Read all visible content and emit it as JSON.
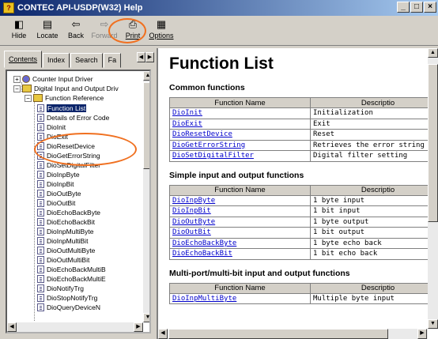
{
  "window": {
    "title": "CONTEC API-USDP(W32) Help"
  },
  "toolbar": {
    "hide": "Hide",
    "locate": "Locate",
    "back": "Back",
    "forward": "Forward",
    "print": "Print",
    "options": "Options"
  },
  "nav_tabs": [
    "Contents",
    "Index",
    "Search",
    "Fa"
  ],
  "tree": [
    "Counter Input Driver",
    "Digital Input and Output Driv",
    "Function Reference",
    "Function List",
    "Details of Error Code",
    "DioInit",
    "DioExit",
    "DioResetDevice",
    "DioGetErrorString",
    "DioSetDigitalFilter",
    "DioInpByte",
    "DioInpBit",
    "DioOutByte",
    "DioOutBit",
    "DioEchoBackByte",
    "DioEchoBackBit",
    "DioInpMultiByte",
    "DioInpMultiBit",
    "DioOutMultiByte",
    "DioOutMultiBit",
    "DioEchoBackMultiB",
    "DioEchoBackMultiE",
    "DioNotifyTrg",
    "DioStopNotifyTrg",
    "DioQueryDeviceN"
  ],
  "page": {
    "title": "Function List",
    "col_name": "Function Name",
    "col_desc": "Descriptio",
    "sections": [
      {
        "heading": "Common functions",
        "rows": [
          [
            "DioInit",
            "Initialization"
          ],
          [
            "DioExit",
            "Exit"
          ],
          [
            "DioResetDevice",
            "Reset"
          ],
          [
            "DioGetErrorString",
            "Retrieves the error string"
          ],
          [
            "DioSetDigitalFilter",
            "Digital filter setting"
          ]
        ]
      },
      {
        "heading": "Simple input and output functions",
        "rows": [
          [
            "DioInpByte",
            "1 byte input"
          ],
          [
            "DioInpBit",
            "1 bit input"
          ],
          [
            "DioOutByte",
            "1 byte output"
          ],
          [
            "DioOutBit",
            "1 bit output"
          ],
          [
            "DioEchoBackByte",
            "1 byte echo back"
          ],
          [
            "DioEchoBackBit",
            "1 bit echo back"
          ]
        ]
      },
      {
        "heading": "Multi-port/multi-bit input and output functions",
        "rows": [
          [
            "DioInpMultiByte",
            "Multiple byte input"
          ]
        ]
      }
    ]
  },
  "colors": {
    "highlight": "#f07020",
    "link": "#0000cc",
    "selection": "#0a246a"
  }
}
